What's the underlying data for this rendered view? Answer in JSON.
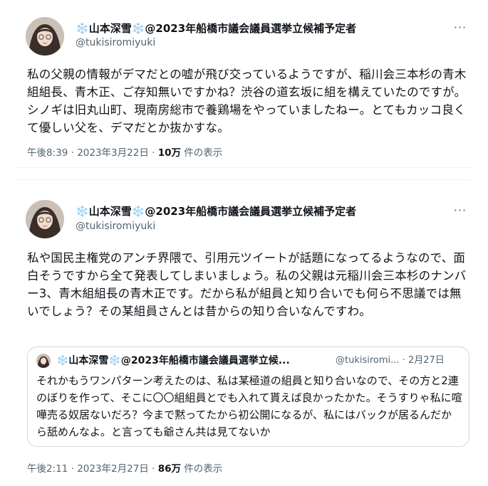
{
  "tweets": [
    {
      "display_name_prefix": "❄️",
      "display_name": "山本深雪",
      "display_name_suffix": "❄️",
      "name_tail": "@2023年船橋市議会議員選挙立候補予定者",
      "handle": "@tukisiromiyuki",
      "more_label": "···",
      "text": "私の父親の情報がデマだとの嘘が飛び交っているようですが、稲川会三本杉の青木組組長、青木正、ご存知無いですかね？渋谷の道玄坂に組を構えていたのですが。シノギは旧丸山町、現南房総市で養鶏場をやっていましたねー。とてもカッコ良くて優しい父を、デマだとか抜かすな。",
      "time": "午後8:39 · 2023年3月22日 · ",
      "views": "10万",
      "views_suffix": " 件の表示"
    },
    {
      "display_name_prefix": "❄️",
      "display_name": "山本深雪",
      "display_name_suffix": "❄️",
      "name_tail": "@2023年船橋市議会議員選挙立候補予定者",
      "handle": "@tukisiromiyuki",
      "more_label": "···",
      "text": "私や国民主権党のアンチ界隈で、引用元ツイートが話題になってるようなので、面白そうですから全て発表してしまいましょう。私の父親は元稲川会三本杉のナンバー3、青木組組長の青木正です。だから私が組員と知り合いでも何ら不思議では無いでしょう？その某組員さんとは昔からの知り合いなんですわ。",
      "quote": {
        "display_name": "❄️山本深雪❄️@2023年船橋市議会議員選挙立候...",
        "handle_date": "@tukisiromi... · 2月27日",
        "text": "それかもうワンパターン考えたのは、私は某極道の組員と知り合いなので、その方と2連のぼりを作って、そこに〇〇組組員とでも入れて貰えば良かったかた。そうすりゃ私に喧嘩売る奴居ないだろ？今まで黙ってたから初公開になるが、私にはバックが居るんだから舐めんなよ。と言っても爺さん共は見てないか"
      },
      "time": "午後2:11 · 2023年2月27日 · ",
      "views": "86万",
      "views_suffix": " 件の表示"
    }
  ]
}
